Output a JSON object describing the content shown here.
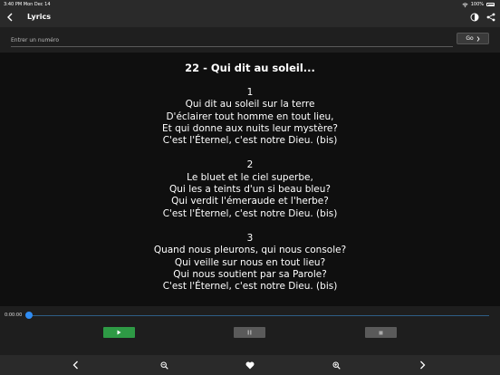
{
  "statusbar": {
    "time": "3:40 PM",
    "date": "Mon Dec 14",
    "battery": "100%"
  },
  "appbar": {
    "title": "Lyrics"
  },
  "search": {
    "placeholder": "Entrer un numéro",
    "go_label": "Go"
  },
  "song": {
    "title": "22 - Qui dit au soleil...",
    "verses": [
      {
        "number": "1",
        "lines": [
          "Qui dit au soleil sur la terre",
          "D'éclairer tout homme en tout lieu,",
          "Et qui donne aux nuits leur mystère?",
          "C'est l'Éternel, c'est notre Dieu. (bis)"
        ]
      },
      {
        "number": "2",
        "lines": [
          "Le bluet et le ciel superbe,",
          "Qui les a teints d'un si beau bleu?",
          "Qui verdit l'émeraude et l'herbe?",
          "C'est l'Éternel, c'est notre Dieu. (bis)"
        ]
      },
      {
        "number": "3",
        "lines": [
          "Quand nous pleurons, qui nous console?",
          "Qui veille sur nous en tout lieu?",
          "Qui nous soutient par sa Parole?",
          "C'est l'Éternel, c'est notre Dieu. (bis)"
        ]
      }
    ]
  },
  "player": {
    "time": "0:00:00",
    "progress": 0
  },
  "colors": {
    "background": "#111111",
    "bar": "#2a2a2a",
    "accent": "#2f8cf3",
    "play": "#2e9a45",
    "disabled": "#5a5a5a"
  },
  "icons": {
    "appbar": [
      "back-chevron-icon",
      "theme-toggle-icon",
      "share-icon"
    ],
    "bottom": [
      "previous-icon",
      "zoom-out-icon",
      "favorite-heart-icon",
      "zoom-in-icon",
      "next-icon"
    ]
  }
}
